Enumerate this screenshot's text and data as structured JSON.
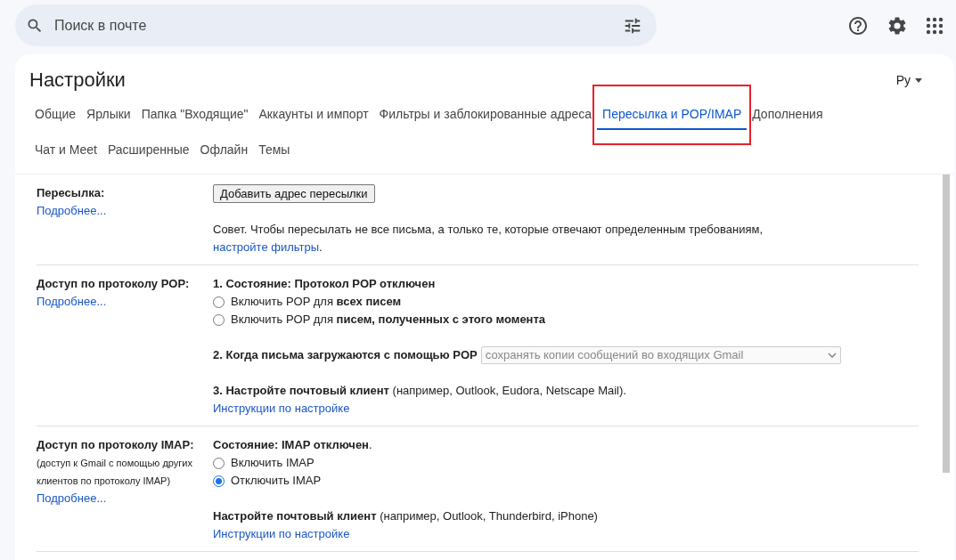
{
  "search": {
    "placeholder": "Поиск в почте"
  },
  "title": "Настройки",
  "language": "Ру",
  "tabs": [
    {
      "label": "Общие",
      "selected": false,
      "highlighted": false
    },
    {
      "label": "Ярлыки",
      "selected": false,
      "highlighted": false
    },
    {
      "label": "Папка \"Входящие\"",
      "selected": false,
      "highlighted": false
    },
    {
      "label": "Аккаунты и импорт",
      "selected": false,
      "highlighted": false
    },
    {
      "label": "Фильтры и заблокированные адреса",
      "selected": false,
      "highlighted": false
    },
    {
      "label": "Пересылка и POP/IMAP",
      "selected": true,
      "highlighted": true
    },
    {
      "label": "Дополнения",
      "selected": false,
      "highlighted": false
    },
    {
      "label": "Чат и Meet",
      "selected": false,
      "highlighted": false
    },
    {
      "label": "Расширенные",
      "selected": false,
      "highlighted": false
    },
    {
      "label": "Офлайн",
      "selected": false,
      "highlighted": false
    },
    {
      "label": "Темы",
      "selected": false,
      "highlighted": false
    }
  ],
  "sections": [
    {
      "label": "Пересылка:",
      "link": "Подробнее...",
      "blocks": [
        [
          {
            "kind": "button",
            "text": "Добавить адрес пересылки"
          }
        ],
        [
          {
            "kind": "tip",
            "text": "Совет. Чтобы пересылать не все письма, а только те, которые отвечают определенным требованиям,",
            "link": "настройте фильтры",
            "after": "."
          }
        ]
      ]
    },
    {
      "label": "Доступ по протоколу POP:",
      "link": "Подробнее...",
      "blocks": [
        [
          {
            "kind": "heading",
            "text": "1. Состояние: Протокол POP отключен"
          },
          {
            "kind": "radio",
            "text": "Включить POP для **всех писем**",
            "selected": false
          },
          {
            "kind": "radio",
            "text": "Включить POP для **писем, полученных с этого момента**",
            "selected": false
          }
        ],
        [
          {
            "kind": "select",
            "text": "2. Когда письма загружаются с помощью POP",
            "value": "сохранять копии сообщений во входящих Gmail",
            "disabled": true
          }
        ],
        [
          {
            "kind": "text",
            "text": "**3. Настройте почтовый клиент** (например, Outlook, Eudora, Netscape Mail)."
          },
          {
            "kind": "link",
            "text": "Инструкции по настройке"
          }
        ]
      ]
    },
    {
      "label": "Доступ по протоколу IMAP:",
      "note": "(доступ к Gmail с помощью других клиентов по протоколу IMAP)",
      "link": "Подробнее...",
      "blocks": [
        [
          {
            "kind": "text",
            "text": "**Состояние: IMAP отключен**."
          },
          {
            "kind": "radio",
            "text": "Включить IMAP",
            "selected": false
          },
          {
            "kind": "radio",
            "text": "Отключить IMAP",
            "selected": true
          }
        ],
        [
          {
            "kind": "text",
            "text": "**Настройте почтовый клиент** (например, Outlook, Thunderbird, iPhone)"
          },
          {
            "kind": "link",
            "text": "Инструкции по настройке"
          }
        ]
      ]
    }
  ]
}
